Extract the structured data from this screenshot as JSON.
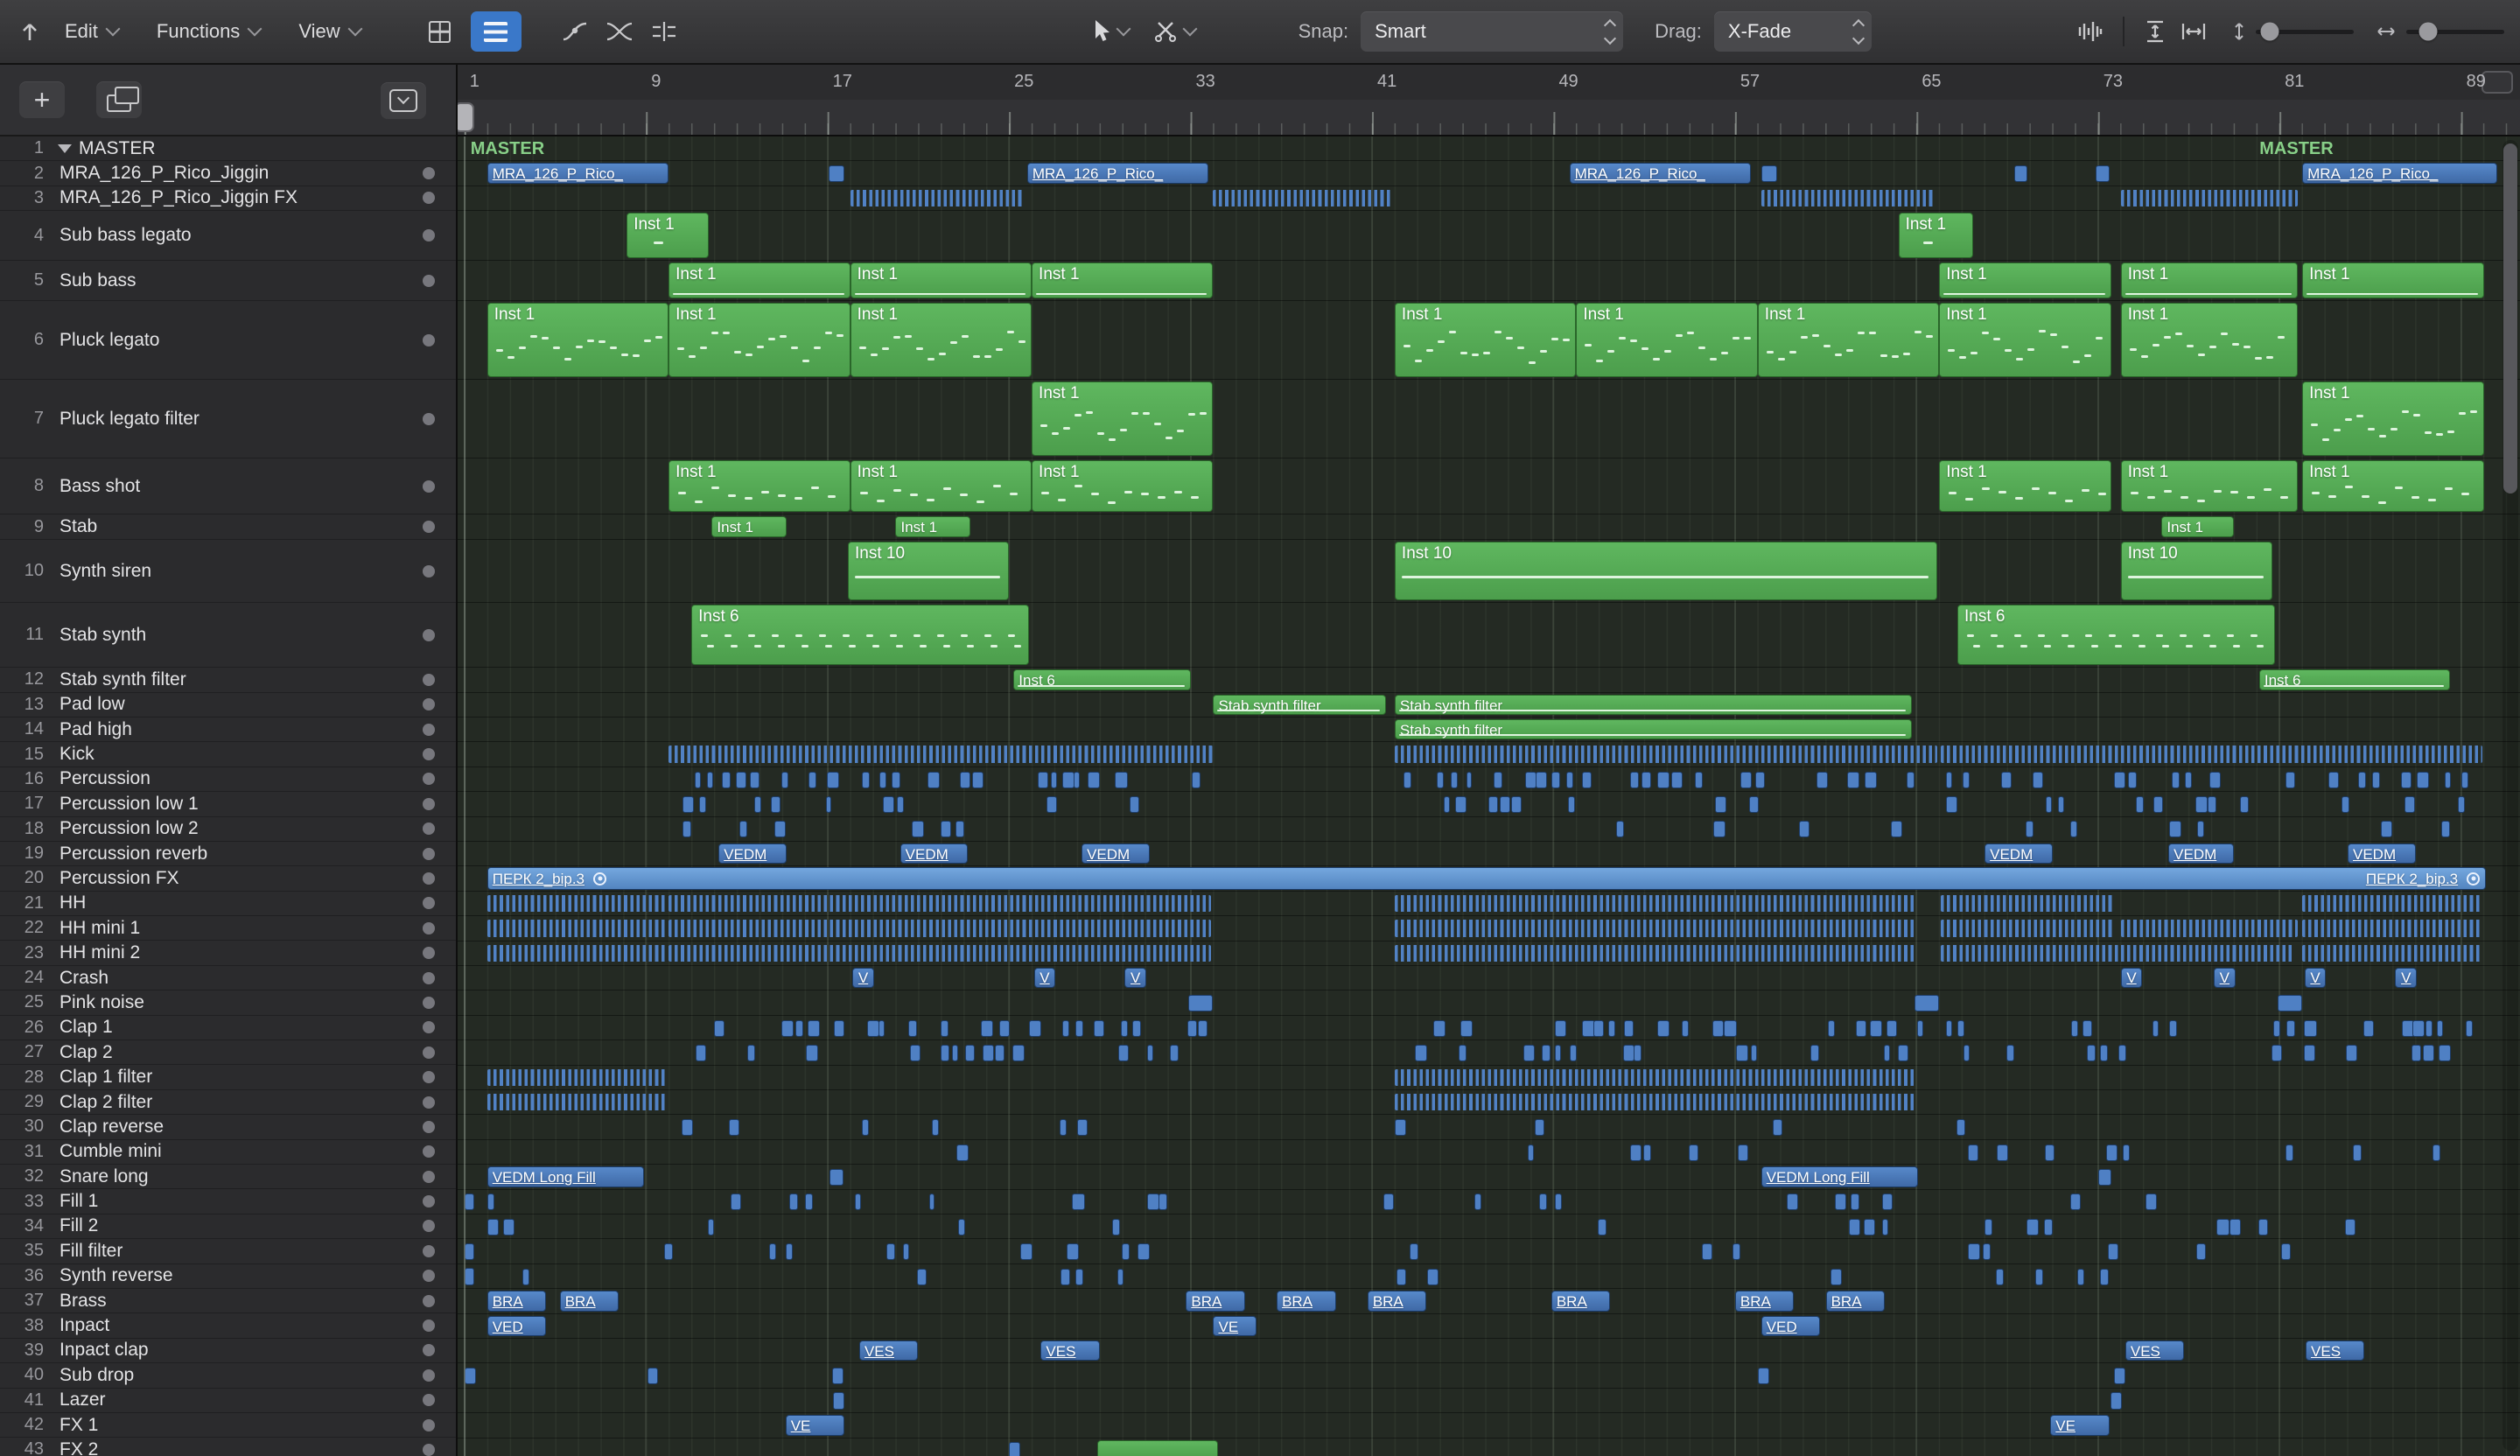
{
  "toolbar": {
    "menus": [
      "Edit",
      "Functions",
      "View"
    ],
    "snap_label": "Snap:",
    "snap_value": "Smart",
    "drag_label": "Drag:",
    "drag_value": "X-Fade"
  },
  "panel": {
    "add_label": "+"
  },
  "ruler": {
    "numbers": [
      1,
      9,
      17,
      25,
      33,
      41,
      49,
      57,
      65,
      73,
      81,
      89
    ]
  },
  "timeline": {
    "x0": 530.8,
    "bar_w": 25.93,
    "end_bar": 90.5
  },
  "colors": {
    "midi_region": "#58ad58",
    "audio_region": "#4d7ec4",
    "audio_region_light": "#669dd8",
    "accent_blue": "#3a78c9",
    "master_text": "#84cc84"
  },
  "master_labels": [
    {
      "text": "MASTER",
      "bar": 1.15
    },
    {
      "text": "MASTER",
      "bar": 80
    }
  ],
  "tracks": [
    {
      "num": "1",
      "name": "MASTER",
      "h": 28.4,
      "disc": true,
      "dot": false
    },
    {
      "num": "2",
      "name": "MRA_126_P_Rico_Jiggin",
      "h": 28.4,
      "dot": true
    },
    {
      "num": "3",
      "name": "MRA_126_P_Rico_Jiggin FX",
      "h": 28.4,
      "dot": true
    },
    {
      "num": "4",
      "name": "Sub bass legato",
      "h": 57,
      "dot": true
    },
    {
      "num": "5",
      "name": "Sub bass",
      "h": 46,
      "dot": true
    },
    {
      "num": "6",
      "name": "Pluck legato",
      "h": 90,
      "dot": true
    },
    {
      "num": "7",
      "name": "Pluck legato filter",
      "h": 90,
      "dot": true
    },
    {
      "num": "8",
      "name": "Bass shot",
      "h": 64,
      "dot": true
    },
    {
      "num": "9",
      "name": "Stab",
      "h": 29,
      "dot": true
    },
    {
      "num": "10",
      "name": "Synth siren",
      "h": 72,
      "dot": true
    },
    {
      "num": "11",
      "name": "Stab synth",
      "h": 74,
      "dot": true
    },
    {
      "num": "12",
      "name": "Stab synth filter",
      "h": 28.4,
      "dot": true
    },
    {
      "num": "13",
      "name": "Pad low",
      "h": 28.4,
      "dot": true
    },
    {
      "num": "14",
      "name": "Pad high",
      "h": 28.4,
      "dot": true
    },
    {
      "num": "15",
      "name": "Kick",
      "h": 28.4,
      "dot": true
    },
    {
      "num": "16",
      "name": "Percussion",
      "h": 28.4,
      "dot": true
    },
    {
      "num": "17",
      "name": "Percussion low 1",
      "h": 28.4,
      "dot": true
    },
    {
      "num": "18",
      "name": "Percussion low 2",
      "h": 28.4,
      "dot": true
    },
    {
      "num": "19",
      "name": "Percussion reverb",
      "h": 28.4,
      "dot": true
    },
    {
      "num": "20",
      "name": "Percussion FX",
      "h": 28.4,
      "dot": true
    },
    {
      "num": "21",
      "name": "HH",
      "h": 28.4,
      "dot": true
    },
    {
      "num": "22",
      "name": "HH mini 1",
      "h": 28.4,
      "dot": true
    },
    {
      "num": "23",
      "name": "HH mini 2",
      "h": 28.4,
      "dot": true
    },
    {
      "num": "24",
      "name": "Crash",
      "h": 28.4,
      "dot": true
    },
    {
      "num": "25",
      "name": "Pink noise",
      "h": 28.4,
      "dot": true
    },
    {
      "num": "26",
      "name": "Clap 1",
      "h": 28.4,
      "dot": true
    },
    {
      "num": "27",
      "name": "Clap 2",
      "h": 28.4,
      "dot": true
    },
    {
      "num": "28",
      "name": "Clap 1 filter",
      "h": 28.4,
      "dot": true
    },
    {
      "num": "29",
      "name": "Clap 2 filter",
      "h": 28.4,
      "dot": true
    },
    {
      "num": "30",
      "name": "Clap reverse",
      "h": 28.4,
      "dot": true
    },
    {
      "num": "31",
      "name": "Cumble mini",
      "h": 28.4,
      "dot": true
    },
    {
      "num": "32",
      "name": "Snare long",
      "h": 28.4,
      "dot": true
    },
    {
      "num": "33",
      "name": "Fill 1",
      "h": 28.4,
      "dot": true
    },
    {
      "num": "34",
      "name": "Fill 2",
      "h": 28.4,
      "dot": true
    },
    {
      "num": "35",
      "name": "Fill filter",
      "h": 28.4,
      "dot": true
    },
    {
      "num": "36",
      "name": "Synth reverse",
      "h": 28.4,
      "dot": true
    },
    {
      "num": "37",
      "name": "Brass",
      "h": 28.4,
      "dot": true
    },
    {
      "num": "38",
      "name": "Inpact",
      "h": 28.4,
      "dot": true
    },
    {
      "num": "39",
      "name": "Inpact clap",
      "h": 28.4,
      "dot": true
    },
    {
      "num": "40",
      "name": "Sub drop",
      "h": 28.4,
      "dot": true
    },
    {
      "num": "41",
      "name": "Lazer",
      "h": 28.4,
      "dot": true
    },
    {
      "num": "42",
      "name": "FX 1",
      "h": 28.4,
      "dot": true
    },
    {
      "num": "43",
      "name": "FX 2",
      "h": 28.4,
      "dot": true
    }
  ],
  "regions": [
    {
      "t": 2,
      "k": "a",
      "s": 2,
      "l": 8,
      "lab": "MRA_126_P_Rico_"
    },
    {
      "t": 2,
      "k": "b",
      "s": 17.05,
      "l": 0.7
    },
    {
      "t": 2,
      "k": "a",
      "s": 25.8,
      "l": 8,
      "lab": "MRA_126_P_Rico_"
    },
    {
      "t": 2,
      "k": "a",
      "s": 49.7,
      "l": 8,
      "lab": "MRA_126_P_Rico_"
    },
    {
      "t": 2,
      "k": "b",
      "s": 58.15,
      "l": 0.7
    },
    {
      "t": 2,
      "k": "b",
      "s": 69.3,
      "l": 0.6
    },
    {
      "t": 2,
      "k": "b",
      "s": 72.9,
      "l": 0.6
    },
    {
      "t": 2,
      "k": "a",
      "s": 82,
      "l": 8.6,
      "lab": "MRA_126_P_Rico_"
    },
    {
      "t": 3,
      "k": "c",
      "s": 18,
      "l": 7.7
    },
    {
      "t": 3,
      "k": "c",
      "s": 34,
      "l": 7.9
    },
    {
      "t": 3,
      "k": "c",
      "s": 58.15,
      "l": 7.6
    },
    {
      "t": 3,
      "k": "c",
      "s": 74,
      "l": 7.8
    },
    {
      "t": 4,
      "k": "m",
      "s": 8.15,
      "l": 3.6,
      "lab": "Inst 1",
      "n": "d1"
    },
    {
      "t": 4,
      "k": "m",
      "s": 64.2,
      "l": 3.3,
      "lab": "Inst 1",
      "n": "d1"
    },
    {
      "t": 5,
      "k": "m",
      "s": 10,
      "l": 8,
      "lab": "Inst 1",
      "n": "thin"
    },
    {
      "t": 5,
      "k": "m",
      "s": 18,
      "l": 8,
      "lab": "Inst 1",
      "n": "thin"
    },
    {
      "t": 5,
      "k": "m",
      "s": 26,
      "l": 8,
      "lab": "Inst 1",
      "n": "thin"
    },
    {
      "t": 5,
      "k": "m",
      "s": 66,
      "l": 7.6,
      "lab": "Inst 1",
      "n": "thin"
    },
    {
      "t": 5,
      "k": "m",
      "s": 74,
      "l": 7.8,
      "lab": "Inst 1",
      "n": "thin"
    },
    {
      "t": 5,
      "k": "m",
      "s": 82,
      "l": 8,
      "lab": "Inst 1",
      "n": "thin"
    },
    {
      "t": 6,
      "k": "m",
      "s": 2,
      "l": 8,
      "lab": "Inst 1",
      "n": "mel"
    },
    {
      "t": 6,
      "k": "m",
      "s": 10,
      "l": 8,
      "lab": "Inst 1",
      "n": "mel"
    },
    {
      "t": 6,
      "k": "m",
      "s": 18,
      "l": 8,
      "lab": "Inst 1",
      "n": "mel"
    },
    {
      "t": 6,
      "k": "m",
      "s": 42,
      "l": 8,
      "lab": "Inst 1",
      "n": "mel"
    },
    {
      "t": 6,
      "k": "m",
      "s": 50,
      "l": 8,
      "lab": "Inst 1",
      "n": "mel"
    },
    {
      "t": 6,
      "k": "m",
      "s": 58,
      "l": 8,
      "lab": "Inst 1",
      "n": "mel"
    },
    {
      "t": 6,
      "k": "m",
      "s": 66,
      "l": 7.6,
      "lab": "Inst 1",
      "n": "mel"
    },
    {
      "t": 6,
      "k": "m",
      "s": 74,
      "l": 7.8,
      "lab": "Inst 1",
      "n": "mel"
    },
    {
      "t": 7,
      "k": "m",
      "s": 26,
      "l": 8,
      "lab": "Inst 1",
      "n": "mel"
    },
    {
      "t": 7,
      "k": "m",
      "s": 82,
      "l": 8,
      "lab": "Inst 1",
      "n": "mel"
    },
    {
      "t": 8,
      "k": "m",
      "s": 10,
      "l": 8,
      "lab": "Inst 1",
      "n": "d2"
    },
    {
      "t": 8,
      "k": "m",
      "s": 18,
      "l": 8,
      "lab": "Inst 1",
      "n": "d2"
    },
    {
      "t": 8,
      "k": "m",
      "s": 26,
      "l": 8,
      "lab": "Inst 1",
      "n": "d2"
    },
    {
      "t": 8,
      "k": "m",
      "s": 66,
      "l": 7.6,
      "lab": "Inst 1",
      "n": "d2"
    },
    {
      "t": 8,
      "k": "m",
      "s": 74,
      "l": 7.8,
      "lab": "Inst 1",
      "n": "d2"
    },
    {
      "t": 8,
      "k": "m",
      "s": 82,
      "l": 8,
      "lab": "Inst 1",
      "n": "d2"
    },
    {
      "t": 9,
      "k": "m",
      "s": 11.9,
      "l": 3.3,
      "lab": "Inst 1"
    },
    {
      "t": 9,
      "k": "m",
      "s": 20,
      "l": 3.3,
      "lab": "Inst 1"
    },
    {
      "t": 9,
      "k": "m",
      "s": 75.8,
      "l": 3.2,
      "lab": "Inst 1"
    },
    {
      "t": 10,
      "k": "m",
      "s": 17.9,
      "l": 7.1,
      "lab": "Inst 10",
      "n": "line"
    },
    {
      "t": 10,
      "k": "m",
      "s": 42,
      "l": 23.9,
      "lab": "Inst 10",
      "n": "line"
    },
    {
      "t": 10,
      "k": "m",
      "s": 74,
      "l": 6.7,
      "lab": "Inst 10",
      "n": "line"
    },
    {
      "t": 11,
      "k": "m",
      "s": 11,
      "l": 14.9,
      "lab": "Inst 6",
      "n": "pair"
    },
    {
      "t": 11,
      "k": "m",
      "s": 66.8,
      "l": 14,
      "lab": "Inst 6",
      "n": "pair"
    },
    {
      "t": 12,
      "k": "m",
      "s": 25.2,
      "l": 7.8,
      "lab": "Inst 6",
      "n": "thin"
    },
    {
      "t": 12,
      "k": "m",
      "s": 80.1,
      "l": 8.4,
      "lab": "Inst 6",
      "n": "thin"
    },
    {
      "t": 13,
      "k": "m",
      "s": 34,
      "l": 7.6,
      "lab": "Stab synth filter",
      "n": "thin"
    },
    {
      "t": 13,
      "k": "m",
      "s": 42,
      "l": 22.8,
      "lab": "Stab synth filter",
      "n": "thin"
    },
    {
      "t": 14,
      "k": "m",
      "s": 42,
      "l": 22.8,
      "lab": "Stab synth filter",
      "n": "thin"
    },
    {
      "t": 15,
      "k": "c",
      "s": 10,
      "l": 24
    },
    {
      "t": 15,
      "k": "c",
      "s": 42,
      "l": 23.9
    },
    {
      "t": 15,
      "k": "c",
      "s": 66.05,
      "l": 23.9
    },
    {
      "t": 19,
      "k": "a",
      "s": 12.2,
      "l": 3,
      "lab": "VEDM"
    },
    {
      "t": 19,
      "k": "a",
      "s": 20.2,
      "l": 3,
      "lab": "VEDM"
    },
    {
      "t": 19,
      "k": "a",
      "s": 28.2,
      "l": 3,
      "lab": "VEDM"
    },
    {
      "t": 19,
      "k": "a",
      "s": 68,
      "l": 3,
      "lab": "VEDM"
    },
    {
      "t": 19,
      "k": "a",
      "s": 76.1,
      "l": 2.9,
      "lab": "VEDM"
    },
    {
      "t": 19,
      "k": "a",
      "s": 84,
      "l": 3,
      "lab": "VEDM"
    },
    {
      "t": 20,
      "k": "L",
      "s": 2,
      "l": 88.1,
      "lab": "ПЕРК 2_bip.3"
    },
    {
      "t": 21,
      "k": "c",
      "s": 2,
      "l": 7.9
    },
    {
      "t": 21,
      "k": "c",
      "s": 10,
      "l": 23.9
    },
    {
      "t": 21,
      "k": "c",
      "s": 42,
      "l": 22.9
    },
    {
      "t": 21,
      "k": "c",
      "s": 66.05,
      "l": 7.7
    },
    {
      "t": 21,
      "k": "c",
      "s": 82,
      "l": 7.9
    },
    {
      "t": 22,
      "k": "c",
      "s": 2,
      "l": 7.9
    },
    {
      "t": 22,
      "k": "c",
      "s": 10,
      "l": 23.9
    },
    {
      "t": 22,
      "k": "c",
      "s": 42,
      "l": 22.9
    },
    {
      "t": 22,
      "k": "c",
      "s": 66.05,
      "l": 7.7
    },
    {
      "t": 22,
      "k": "c",
      "s": 74,
      "l": 7.8
    },
    {
      "t": 22,
      "k": "c",
      "s": 82,
      "l": 7.9
    },
    {
      "t": 23,
      "k": "c",
      "s": 2,
      "l": 7.9
    },
    {
      "t": 23,
      "k": "c",
      "s": 10,
      "l": 23.9
    },
    {
      "t": 23,
      "k": "c",
      "s": 42,
      "l": 22.9
    },
    {
      "t": 23,
      "k": "c",
      "s": 66.05,
      "l": 15.6
    },
    {
      "t": 23,
      "k": "c",
      "s": 82,
      "l": 7.9
    },
    {
      "t": 24,
      "k": "a",
      "s": 18.1,
      "l": 0.95,
      "lab": "V"
    },
    {
      "t": 24,
      "k": "a",
      "s": 26.1,
      "l": 0.95,
      "lab": "V"
    },
    {
      "t": 24,
      "k": "a",
      "s": 30.1,
      "l": 0.95,
      "lab": "V"
    },
    {
      "t": 24,
      "k": "a",
      "s": 74,
      "l": 0.95,
      "lab": "V"
    },
    {
      "t": 24,
      "k": "a",
      "s": 78.1,
      "l": 0.95,
      "lab": "V"
    },
    {
      "t": 24,
      "k": "a",
      "s": 82.1,
      "l": 0.95,
      "lab": "V"
    },
    {
      "t": 24,
      "k": "a",
      "s": 86.1,
      "l": 0.95,
      "lab": "V"
    },
    {
      "t": 25,
      "k": "b",
      "s": 32.9,
      "l": 1.1
    },
    {
      "t": 25,
      "k": "b",
      "s": 64.9,
      "l": 1.1
    },
    {
      "t": 25,
      "k": "b",
      "s": 80.9,
      "l": 1.1
    },
    {
      "t": 28,
      "k": "c",
      "s": 2,
      "l": 7.9
    },
    {
      "t": 28,
      "k": "c",
      "s": 42,
      "l": 22.9
    },
    {
      "t": 29,
      "k": "c",
      "s": 2,
      "l": 7.9
    },
    {
      "t": 29,
      "k": "c",
      "s": 42,
      "l": 22.9
    },
    {
      "t": 32,
      "k": "a",
      "s": 2,
      "l": 6.9,
      "lab": "VEDM Long Fill"
    },
    {
      "t": 32,
      "k": "b",
      "s": 17.1,
      "l": 0.6
    },
    {
      "t": 32,
      "k": "a",
      "s": 58.15,
      "l": 6.9,
      "lab": "VEDM Long Fill"
    },
    {
      "t": 32,
      "k": "b",
      "s": 73,
      "l": 0.6
    },
    {
      "t": 33,
      "k": "b",
      "s": 1,
      "l": 0.45
    },
    {
      "t": 35,
      "k": "b",
      "s": 1,
      "l": 0.45
    },
    {
      "t": 36,
      "k": "b",
      "s": 1,
      "l": 0.45
    },
    {
      "t": 37,
      "k": "a",
      "s": 2,
      "l": 2.6,
      "lab": "BRA"
    },
    {
      "t": 37,
      "k": "a",
      "s": 5.2,
      "l": 2.6,
      "lab": "BRA"
    },
    {
      "t": 37,
      "k": "a",
      "s": 32.8,
      "l": 2.6,
      "lab": "BRA"
    },
    {
      "t": 37,
      "k": "a",
      "s": 36.8,
      "l": 2.6,
      "lab": "BRA"
    },
    {
      "t": 37,
      "k": "a",
      "s": 40.8,
      "l": 2.6,
      "lab": "BRA"
    },
    {
      "t": 37,
      "k": "a",
      "s": 48.9,
      "l": 2.6,
      "lab": "BRA"
    },
    {
      "t": 37,
      "k": "a",
      "s": 57,
      "l": 2.6,
      "lab": "BRA"
    },
    {
      "t": 37,
      "k": "a",
      "s": 61,
      "l": 2.6,
      "lab": "BRA"
    },
    {
      "t": 38,
      "k": "a",
      "s": 2,
      "l": 2.6,
      "lab": "VED"
    },
    {
      "t": 38,
      "k": "a",
      "s": 34,
      "l": 1.9,
      "lab": "VE"
    },
    {
      "t": 38,
      "k": "a",
      "s": 58.15,
      "l": 2.6,
      "lab": "VED"
    },
    {
      "t": 39,
      "k": "a",
      "s": 18.4,
      "l": 2.6,
      "lab": "VES"
    },
    {
      "t": 39,
      "k": "a",
      "s": 26.4,
      "l": 2.6,
      "lab": "VES"
    },
    {
      "t": 39,
      "k": "a",
      "s": 74.2,
      "l": 2.6,
      "lab": "VES"
    },
    {
      "t": 39,
      "k": "a",
      "s": 82.15,
      "l": 2.6,
      "lab": "VES"
    },
    {
      "t": 40,
      "k": "b",
      "s": 1,
      "l": 0.5
    },
    {
      "t": 40,
      "k": "b",
      "s": 9.05,
      "l": 0.5
    },
    {
      "t": 40,
      "k": "b",
      "s": 17.2,
      "l": 0.5
    },
    {
      "t": 40,
      "k": "b",
      "s": 58,
      "l": 0.5
    },
    {
      "t": 40,
      "k": "b",
      "s": 73.7,
      "l": 0.5
    },
    {
      "t": 41,
      "k": "b",
      "s": 17.25,
      "l": 0.5
    },
    {
      "t": 41,
      "k": "b",
      "s": 73.55,
      "l": 0.5
    },
    {
      "t": 42,
      "k": "a",
      "s": 15.15,
      "l": 2.6,
      "lab": "VE"
    },
    {
      "t": 42,
      "k": "a",
      "s": 70.9,
      "l": 2.6,
      "lab": "VE"
    },
    {
      "t": 43,
      "k": "b",
      "s": 25,
      "l": 0.5
    },
    {
      "t": 43,
      "k": "m",
      "s": 28.9,
      "l": 5.3,
      "lab": ""
    }
  ],
  "sparse": [
    {
      "t": 16,
      "d": 0.46,
      "ranges": [
        [
          10.6,
          33.6
        ],
        [
          42.4,
          65.2
        ],
        [
          66.3,
          89.3
        ]
      ]
    },
    {
      "t": 17,
      "d": 0.24,
      "ranges": [
        [
          10.6,
          33.6
        ],
        [
          42.4,
          65.2
        ],
        [
          66.3,
          89.3
        ]
      ]
    },
    {
      "t": 18,
      "d": 0.2,
      "ranges": [
        [
          10.6,
          33.6
        ],
        [
          42.4,
          65.2
        ],
        [
          66.3,
          89.3
        ]
      ]
    },
    {
      "t": 26,
      "d": 0.5,
      "ranges": [
        [
          10.6,
          33.6
        ],
        [
          42.4,
          65.2
        ],
        [
          66.3,
          89.3
        ]
      ]
    },
    {
      "t": 27,
      "d": 0.3,
      "ranges": [
        [
          10.6,
          33.6
        ],
        [
          42.4,
          65.2
        ],
        [
          66.3,
          89.3
        ]
      ]
    },
    {
      "t": 30,
      "d": 0.12,
      "ranges": [
        [
          10,
          33.5
        ],
        [
          42,
          65
        ],
        [
          66,
          82
        ]
      ]
    },
    {
      "t": 31,
      "d": 0.12,
      "ranges": [
        [
          14,
          33.5
        ],
        [
          42,
          65
        ],
        [
          66,
          89
        ]
      ]
    },
    {
      "t": 33,
      "d": 0.14,
      "ranges": [
        [
          2,
          33.5
        ],
        [
          41.5,
          65
        ],
        [
          66,
          89.5
        ]
      ]
    },
    {
      "t": 34,
      "d": 0.12,
      "ranges": [
        [
          2,
          33.5
        ],
        [
          41.5,
          65
        ],
        [
          66,
          89.5
        ]
      ]
    },
    {
      "t": 35,
      "d": 0.14,
      "ranges": [
        [
          2,
          33.5
        ],
        [
          41.5,
          65
        ],
        [
          66,
          89.5
        ]
      ]
    },
    {
      "t": 36,
      "d": 0.09,
      "ranges": [
        [
          2,
          33.5
        ],
        [
          41.5,
          65
        ],
        [
          66,
          89.5
        ]
      ]
    }
  ]
}
